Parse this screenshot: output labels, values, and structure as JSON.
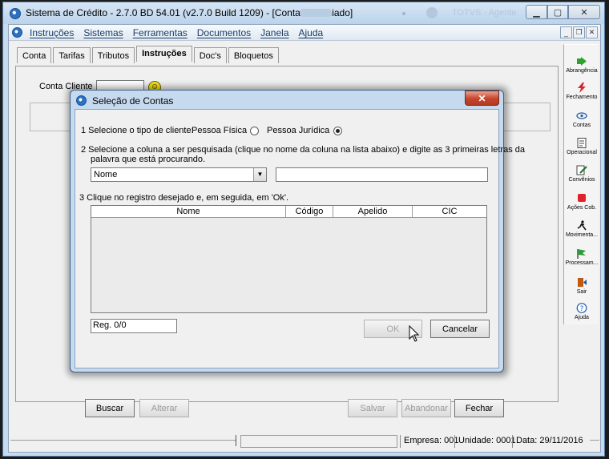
{
  "window": {
    "title": "Sistema de Crédito - 2.7.0 BD 54.01 (v2.7.0 Build 1209) - [Conta Financiado]",
    "ghost_text": "TOTVS · Agente"
  },
  "menu": {
    "items": [
      "Instruções",
      "Sistemas",
      "Ferramentas",
      "Documentos",
      "Janela",
      "Ajuda"
    ]
  },
  "form": {
    "tabs": [
      "Conta",
      "Tarifas",
      "Tributos",
      "Instruções",
      "Doc's",
      "Bloquetos"
    ],
    "active_tab": "Instruções",
    "conta_cliente_label": "Conta Cliente",
    "buttons": {
      "buscar": "Buscar",
      "alterar": "Alterar",
      "salvar": "Salvar",
      "abandonar": "Abandonar",
      "fechar": "Fechar"
    }
  },
  "toolbar": {
    "items": [
      {
        "label": "Abrangência",
        "icon": "arrow-play-icon"
      },
      {
        "label": "Fechamento",
        "icon": "lightning-icon"
      },
      {
        "label": "Contas",
        "icon": "eye-icon"
      },
      {
        "label": "Operacional",
        "icon": "document-icon"
      },
      {
        "label": "Convênios",
        "icon": "edit-document-icon"
      },
      {
        "label": "Ações Cob.",
        "icon": "red-square-icon"
      },
      {
        "label": "Movimenta...",
        "icon": "running-man-icon"
      },
      {
        "label": "Processam...",
        "icon": "flag-icon"
      },
      {
        "label": "Sair",
        "icon": "exit-door-icon"
      },
      {
        "label": "Ajuda",
        "icon": "help-icon"
      }
    ]
  },
  "statusbar": {
    "empresa": "Empresa: 001",
    "unidade": "Unidade: 0001",
    "data": "Data:  29/11/2016"
  },
  "dialog": {
    "title": "Seleção de Contas",
    "step1": "1  Selecione o tipo de cliente:",
    "radio_fisica": "Pessoa Física",
    "radio_juridica": "Pessoa Jurídica",
    "selected_type": "Pessoa Jurídica",
    "step2_line1": "2  Selecione a coluna a ser pesquisada (clique no nome da coluna na lista abaixo) e digite as 3 primeiras  letras da",
    "step2_line2": "palavra que está procurando.",
    "column_select_value": "Nome",
    "search_value": "",
    "step3": "3  Clique no registro desejado e, em seguida, em 'Ok'.",
    "grid_columns": [
      "Nome",
      "Código",
      "Apelido",
      "CIC"
    ],
    "grid_rows": [],
    "reg_count": "Reg. 0/0",
    "ok_label": "OK",
    "cancel_label": "Cancelar"
  }
}
